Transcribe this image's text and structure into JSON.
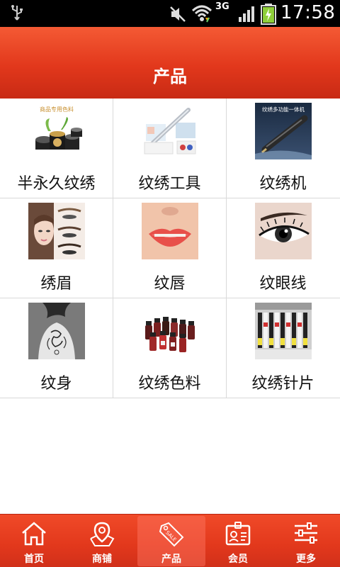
{
  "status_bar": {
    "network": "3G",
    "time": "17:58"
  },
  "header": {
    "title": "产品"
  },
  "products": [
    {
      "label": "半永久纹绣",
      "image_caption": "商品专用色料",
      "icon": "cosmetic-jars-image"
    },
    {
      "label": "纹绣工具",
      "icon": "tattoo-pen-kit-image"
    },
    {
      "label": "纹绣机",
      "image_caption": "纹绣多功能一体机",
      "icon": "tattoo-machine-image"
    },
    {
      "label": "绣眉",
      "icon": "eyebrow-model-image"
    },
    {
      "label": "纹唇",
      "icon": "lips-image"
    },
    {
      "label": "纹眼线",
      "icon": "eyeliner-image"
    },
    {
      "label": "纹身",
      "icon": "back-tattoo-image"
    },
    {
      "label": "纹绣色料",
      "icon": "pigment-bottles-image"
    },
    {
      "label": "纹绣针片",
      "icon": "needle-cartridges-image"
    }
  ],
  "bottom_nav": [
    {
      "label": "首页",
      "icon": "home-icon",
      "active": false
    },
    {
      "label": "商铺",
      "icon": "map-pin-icon",
      "active": false
    },
    {
      "label": "产品",
      "icon": "sale-tag-icon",
      "active": true
    },
    {
      "label": "会员",
      "icon": "member-card-icon",
      "active": false
    },
    {
      "label": "更多",
      "icon": "settings-sliders-icon",
      "active": false
    }
  ],
  "colors": {
    "brand_red": "#e2381c",
    "status_bar": "#000000",
    "grid_line": "#d9d9d9"
  }
}
